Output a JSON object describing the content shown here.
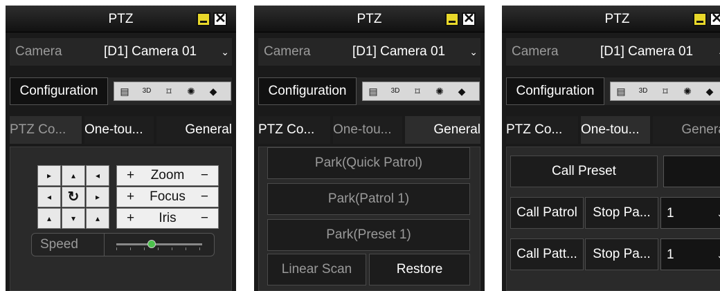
{
  "panels": [
    {
      "title": "PTZ",
      "camera_label": "Camera",
      "camera_value": "[D1] Camera 01",
      "config_label": "Configuration",
      "tabs": [
        "PTZ Co...",
        "One-tou...",
        "General"
      ],
      "controls": {
        "zoom": "Zoom",
        "focus": "Focus",
        "iris": "Iris",
        "plus": "+",
        "minus": "−",
        "speed_label": "Speed",
        "speed_level": 0.4
      }
    },
    {
      "title": "PTZ",
      "camera_label": "Camera",
      "camera_value": "[D1] Camera 01",
      "config_label": "Configuration",
      "tabs": [
        "PTZ Co...",
        "One-tou...",
        "General"
      ],
      "buttons": [
        "Park(Quick Patrol)",
        "Park(Patrol 1)",
        "Park(Preset 1)",
        "Linear Scan",
        "Restore"
      ]
    },
    {
      "title": "PTZ",
      "camera_label": "Camera",
      "camera_value": "[D1] Camera 01",
      "config_label": "Configuration",
      "tabs": [
        "PTZ Co...",
        "One-tou...",
        "General"
      ],
      "buttons": {
        "call_preset": "Call Preset",
        "call_patrol": "Call Patrol",
        "stop_patrol": "Stop Pa...",
        "patrol_value": "1",
        "call_pattern": "Call Patt...",
        "stop_pattern": "Stop Pa...",
        "pattern_value": "1"
      }
    }
  ]
}
